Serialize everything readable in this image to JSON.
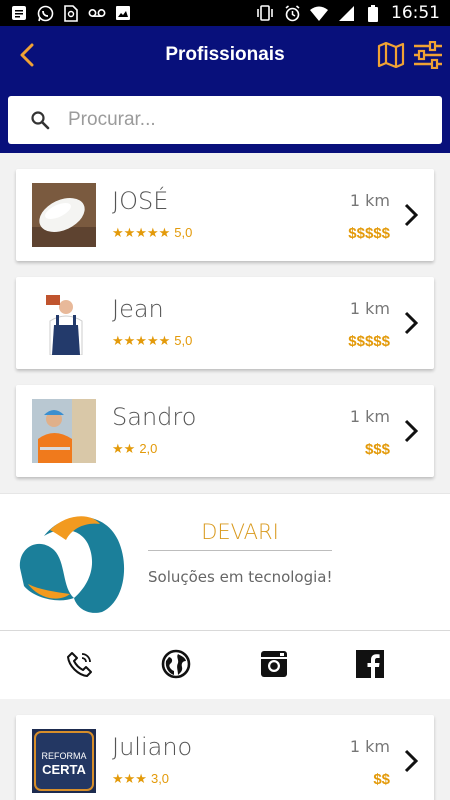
{
  "status_bar": {
    "time": "16:51",
    "left_icons": [
      "message-icon",
      "whatsapp-icon",
      "sim-icon",
      "voicemail-icon",
      "image-icon"
    ],
    "right_icons": [
      "vibrate-icon",
      "alarm-icon",
      "wifi-icon",
      "signal-icon",
      "battery-icon"
    ]
  },
  "header": {
    "title": "Profissionais",
    "back_icon": "chevron-left-icon",
    "map_icon": "map-icon",
    "filter_icon": "sliders-icon"
  },
  "search": {
    "placeholder": "Procurar...",
    "value": ""
  },
  "professionals": [
    {
      "name": "JOSÉ",
      "stars": "★★★★★",
      "rating": "5,0",
      "distance": "1 km",
      "price": "$$$$$"
    },
    {
      "name": "Jean",
      "stars": "★★★★★",
      "rating": "5,0",
      "distance": "1 km",
      "price": "$$$$$"
    },
    {
      "name": "Sandro",
      "stars": "★★",
      "rating": "2,0",
      "distance": "1 km",
      "price": "$$$"
    },
    {
      "name": "Juliano",
      "stars": "★★★",
      "rating": "3,0",
      "distance": "1 km",
      "price": "$$",
      "logo_text": [
        "REFORMA",
        "CERTA"
      ]
    }
  ],
  "ad": {
    "brand": "DEVARI",
    "tagline": "Soluções em tecnologia!",
    "social": [
      "phone-icon",
      "globe-icon",
      "instagram-icon",
      "facebook-icon"
    ]
  },
  "colors": {
    "header_bg": "#08107b",
    "accent": "#e39a0a",
    "brand_teal": "#1b7f9a",
    "brand_orange": "#f29a1f"
  }
}
